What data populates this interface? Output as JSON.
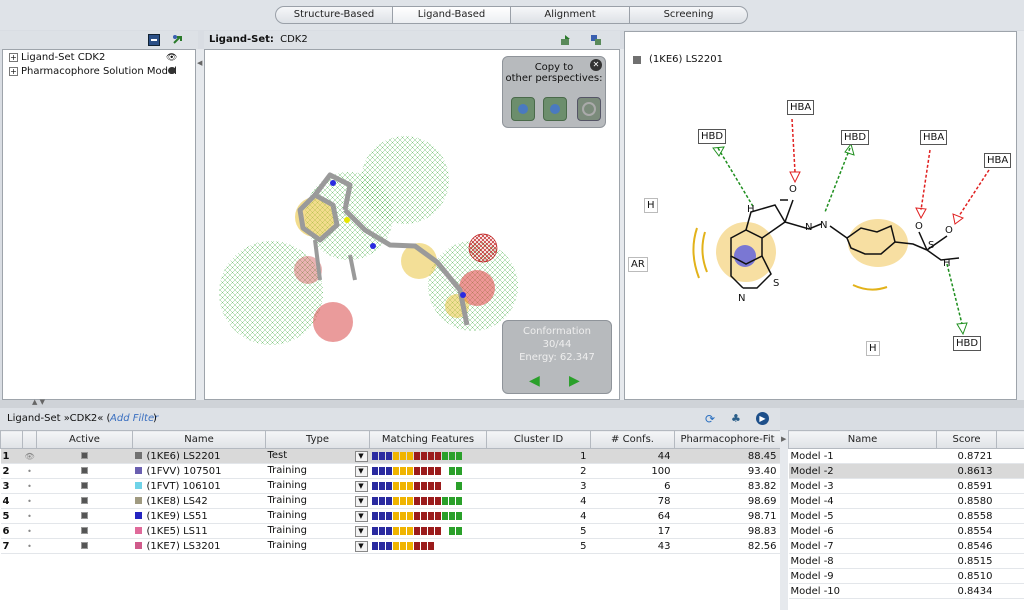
{
  "tabs": [
    "Structure-Based",
    "Ligand-Based",
    "Alignment",
    "Screening"
  ],
  "tree": {
    "items": [
      {
        "label": "Ligand-Set CDK2"
      },
      {
        "label": "Pharmacophore Solution Model"
      }
    ]
  },
  "viewer": {
    "header_bold": "Ligand-Set:",
    "header_name": "CDK2",
    "copy_title_line1": "Copy to",
    "copy_title_line2": "other perspectives:",
    "conformation_label": "Conformation",
    "conformation_value": "30/44",
    "energy_label": "Energy: 62.347"
  },
  "structure": {
    "legend_label": "(1KE6) LS2201",
    "labels": {
      "hbd1": "HBD",
      "hba1": "HBA",
      "hbd2": "HBD",
      "hba2": "HBA",
      "hba3": "HBA",
      "hbd3": "HBD",
      "h1": "H",
      "ar": "AR",
      "h2": "H",
      "n_ring": "N",
      "s_ring": "S",
      "nh1": "H",
      "o1": "O",
      "n1": "N",
      "n2": "N",
      "s2": "S",
      "o2": "O",
      "o3": "O",
      "nh2": "H"
    }
  },
  "ligand_set": {
    "title": "Ligand-Set »CDK2« (",
    "add_filter": "Add Filter",
    "title_end": ")",
    "columns": [
      "Active",
      "Name",
      "Type",
      "Matching Features",
      "Cluster ID",
      "# Confs.",
      "Pharmacophore-Fit"
    ],
    "rows": [
      {
        "idx": "1",
        "name": "(1KE6) LS2201",
        "type": "Test",
        "cluster": "1",
        "confs": "44",
        "fit": "88.45",
        "color": "#707070",
        "features": [
          "#2a2aa0",
          "#2a2aa0",
          "#2a2aa0",
          "#f0b400",
          "#f0b400",
          "#f0b400",
          "#9b1b1b",
          "#9b1b1b",
          "#9b1b1b",
          "#9b1b1b",
          "#2aa02a",
          "#2aa02a",
          "#2aa02a"
        ]
      },
      {
        "idx": "2",
        "name": "(1FVV) 107501",
        "type": "Training",
        "cluster": "2",
        "confs": "100",
        "fit": "93.40",
        "color": "#6a5fb0",
        "features": [
          "#2a2aa0",
          "#2a2aa0",
          "#2a2aa0",
          "#f0b400",
          "#f0b400",
          "#f0b400",
          "#9b1b1b",
          "#9b1b1b",
          "#9b1b1b",
          "#9b1b1b",
          "",
          "#2aa02a",
          "#2aa02a"
        ]
      },
      {
        "idx": "3",
        "name": "(1FVT) 106101",
        "type": "Training",
        "cluster": "3",
        "confs": "6",
        "fit": "83.82",
        "color": "#6fd3e8",
        "features": [
          "#2a2aa0",
          "#2a2aa0",
          "#2a2aa0",
          "#f0b400",
          "#f0b400",
          "#f0b400",
          "#9b1b1b",
          "#9b1b1b",
          "#9b1b1b",
          "#9b1b1b",
          "",
          "",
          "#2aa02a"
        ]
      },
      {
        "idx": "4",
        "name": "(1KE8) LS42",
        "type": "Training",
        "cluster": "4",
        "confs": "78",
        "fit": "98.69",
        "color": "#a09a80",
        "features": [
          "#2a2aa0",
          "#2a2aa0",
          "#2a2aa0",
          "#f0b400",
          "#f0b400",
          "#f0b400",
          "#9b1b1b",
          "#9b1b1b",
          "#9b1b1b",
          "#9b1b1b",
          "#2aa02a",
          "#2aa02a",
          "#2aa02a"
        ]
      },
      {
        "idx": "5",
        "name": "(1KE9) LS51",
        "type": "Training",
        "cluster": "4",
        "confs": "64",
        "fit": "98.71",
        "color": "#2424c0",
        "features": [
          "#2a2aa0",
          "#2a2aa0",
          "#2a2aa0",
          "#f0b400",
          "#f0b400",
          "#f0b400",
          "#9b1b1b",
          "#9b1b1b",
          "#9b1b1b",
          "#9b1b1b",
          "#2aa02a",
          "#2aa02a",
          "#2aa02a"
        ]
      },
      {
        "idx": "6",
        "name": "(1KE5) LS11",
        "type": "Training",
        "cluster": "5",
        "confs": "17",
        "fit": "98.83",
        "color": "#e06a9a",
        "features": [
          "#2a2aa0",
          "#2a2aa0",
          "#2a2aa0",
          "#f0b400",
          "#f0b400",
          "#f0b400",
          "#9b1b1b",
          "#9b1b1b",
          "#9b1b1b",
          "#9b1b1b",
          "",
          "#2aa02a",
          "#2aa02a"
        ]
      },
      {
        "idx": "7",
        "name": "(1KE7) LS3201",
        "type": "Training",
        "cluster": "5",
        "confs": "43",
        "fit": "82.56",
        "color": "#d05a8a",
        "features": [
          "#2a2aa0",
          "#2a2aa0",
          "#2a2aa0",
          "#f0b400",
          "#f0b400",
          "#f0b400",
          "#9b1b1b",
          "#9b1b1b",
          "#9b1b1b",
          "",
          "",
          "",
          ""
        ]
      }
    ]
  },
  "models": {
    "columns": [
      "Name",
      "Score"
    ],
    "rows": [
      {
        "name": "Model -1",
        "score": "0.8721"
      },
      {
        "name": "Model -2",
        "score": "0.8613"
      },
      {
        "name": "Model -3",
        "score": "0.8591"
      },
      {
        "name": "Model -4",
        "score": "0.8580"
      },
      {
        "name": "Model -5",
        "score": "0.8558"
      },
      {
        "name": "Model -6",
        "score": "0.8554"
      },
      {
        "name": "Model -7",
        "score": "0.8546"
      },
      {
        "name": "Model -8",
        "score": "0.8515"
      },
      {
        "name": "Model -9",
        "score": "0.8510"
      },
      {
        "name": "Model -10",
        "score": "0.8434"
      }
    ]
  },
  "colors": {
    "accent_green": "#2aa02a",
    "selected_row": "#d9d9d9"
  }
}
